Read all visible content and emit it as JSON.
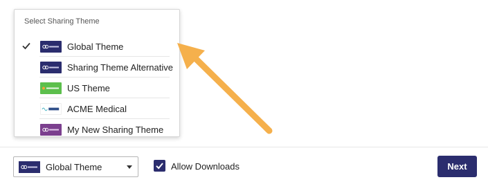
{
  "popup": {
    "title": "Select Sharing Theme",
    "options": [
      {
        "label": "Global Theme",
        "logo_text": "Sharepad",
        "selected": true
      },
      {
        "label": "Sharing Theme Alternative",
        "logo_text": "Sharepad",
        "selected": false
      },
      {
        "label": "US Theme",
        "logo_text": "Principal",
        "selected": false
      },
      {
        "label": "ACME Medical",
        "logo_text": "ACME",
        "selected": false
      },
      {
        "label": "My New Sharing Theme",
        "logo_text": "Sharepad",
        "selected": false
      }
    ]
  },
  "footer": {
    "theme_select": {
      "value": "Global Theme",
      "logo_text": "Sharepad"
    },
    "allow_downloads": {
      "label": "Allow Downloads",
      "checked": true
    },
    "next_label": "Next"
  },
  "colors": {
    "brand": "#2b2d6e",
    "arrow": "#f5b04c",
    "us_logo": "#5cbf4c",
    "purple_logo": "#7b3f8e"
  }
}
